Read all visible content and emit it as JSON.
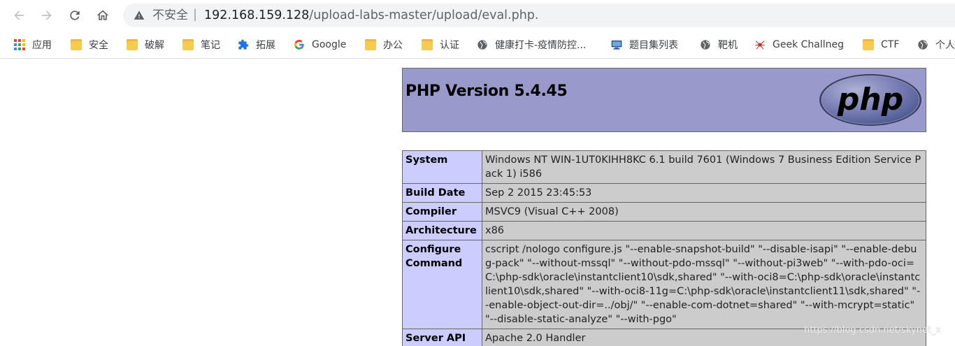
{
  "browser": {
    "address": {
      "security_label": "不安全",
      "separator": "|",
      "host": "192.168.159.128",
      "path": "/upload-labs-master/upload/eval.php."
    },
    "bookmarks": [
      {
        "label": "应用",
        "icon": "apps-grid-icon"
      },
      {
        "label": "安全",
        "icon": "folder-icon"
      },
      {
        "label": "破解",
        "icon": "folder-icon"
      },
      {
        "label": "笔记",
        "icon": "folder-icon"
      },
      {
        "label": "拓展",
        "icon": "puzzle-icon"
      },
      {
        "label": "Google",
        "icon": "google-icon"
      },
      {
        "label": "办公",
        "icon": "folder-icon"
      },
      {
        "label": "认证",
        "icon": "folder-icon"
      },
      {
        "label": "健康打卡-疫情防控...",
        "icon": "globe-icon"
      },
      {
        "label": "题目集列表",
        "icon": "monitor-icon"
      },
      {
        "label": "靶机",
        "icon": "globe-icon"
      },
      {
        "label": "Geek Challneg",
        "icon": "spider-icon"
      },
      {
        "label": "CTF",
        "icon": "folder-icon"
      },
      {
        "label": "个人",
        "icon": "globe-icon"
      }
    ]
  },
  "php": {
    "title": "PHP Version 5.4.45",
    "logo_text": "php",
    "rows": [
      {
        "key": "System",
        "value": "Windows NT WIN-1UT0KIHH8KC 6.1 build 7601 (Windows 7 Business Edition Service Pack 1) i586"
      },
      {
        "key": "Build Date",
        "value": "Sep 2 2015 23:45:53"
      },
      {
        "key": "Compiler",
        "value": "MSVC9 (Visual C++ 2008)"
      },
      {
        "key": "Architecture",
        "value": "x86"
      },
      {
        "key": "Configure Command",
        "value": "cscript /nologo configure.js \"--enable-snapshot-build\" \"--disable-isapi\" \"--enable-debug-pack\" \"--without-mssql\" \"--without-pdo-mssql\" \"--without-pi3web\" \"--with-pdo-oci=C:\\php-sdk\\oracle\\instantclient10\\sdk,shared\" \"--with-oci8=C:\\php-sdk\\oracle\\instantclient10\\sdk,shared\" \"--with-oci8-11g=C:\\php-sdk\\oracle\\instantclient11\\sdk,shared\" \"--enable-object-out-dir=../obj/\" \"--enable-com-dotnet=shared\" \"--with-mcrypt=static\" \"--disable-static-analyze\" \"--with-pgo\""
      },
      {
        "key": "Server API",
        "value": "Apache 2.0 Handler"
      }
    ]
  },
  "watermark": "https://blog.csdn.net/skynet_x",
  "colors": {
    "header_bg": "#9999cc",
    "key_bg": "#ccccff",
    "value_bg": "#cccccc",
    "omnibox_bg": "#f1f3f4"
  }
}
